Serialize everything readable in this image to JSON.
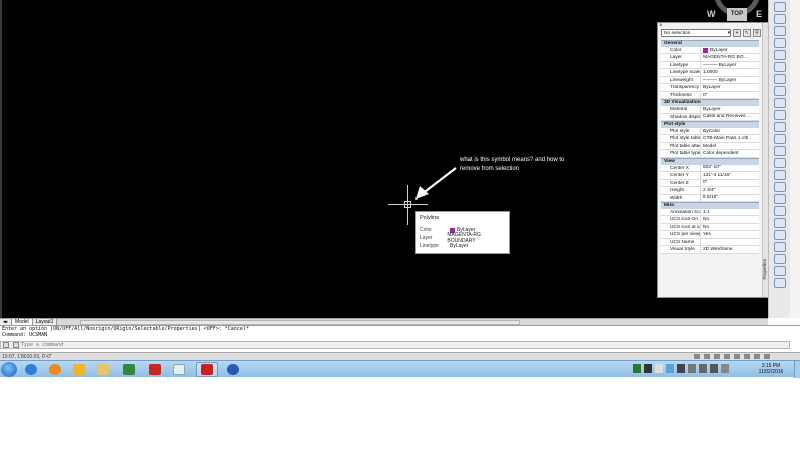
{
  "viewcube": {
    "top_label": "TOP",
    "west": "W",
    "east": "E"
  },
  "annotation": {
    "text": "what is this symbol means? and how to remove from selection"
  },
  "tooltip": {
    "title": "Polyline",
    "rows": [
      {
        "key": "Color",
        "value": "ByLayer",
        "swatch": "#a0239a"
      },
      {
        "key": "Layer",
        "value": "MAGENTA-RG BOUNDARY"
      },
      {
        "key": "Linetype",
        "value": "ByLayer"
      }
    ]
  },
  "properties": {
    "close": "×",
    "selection": "No selection",
    "palette_tab": "Properties",
    "sections": [
      {
        "title": "General",
        "rows": [
          {
            "key": "Color",
            "value": "ByLayer",
            "swatch": "#a0239a"
          },
          {
            "key": "Layer",
            "value": "MAGENTA-RG BO..."
          },
          {
            "key": "Linetype",
            "value": "——— ByLayer"
          },
          {
            "key": "Linetype scale",
            "value": "1.0000"
          },
          {
            "key": "Lineweight",
            "value": "——— ByLayer"
          },
          {
            "key": "Transparency",
            "value": "ByLayer"
          },
          {
            "key": "Thickness",
            "value": "0\""
          }
        ]
      },
      {
        "title": "3D Visualization",
        "rows": [
          {
            "key": "Material",
            "value": "ByLayer"
          },
          {
            "key": "Shadow display",
            "value": "Casts and Receives ..."
          }
        ]
      },
      {
        "title": "Plot style",
        "rows": [
          {
            "key": "Plot style",
            "value": "ByColor"
          },
          {
            "key": "Plot style table",
            "value": "CTB-Main Pass 1.ctb"
          },
          {
            "key": "Plot table attac...",
            "value": "Model"
          },
          {
            "key": "Plot table type",
            "value": "Color dependent"
          }
        ]
      },
      {
        "title": "View",
        "rows": [
          {
            "key": "Center X",
            "value": "502'-10\""
          },
          {
            "key": "Center Y",
            "value": "131'-3 11/16\""
          },
          {
            "key": "Center Z",
            "value": "0\""
          },
          {
            "key": "Height",
            "value": "2 3/4\""
          },
          {
            "key": "Width",
            "value": "6 5/16\""
          }
        ]
      },
      {
        "title": "Misc",
        "rows": [
          {
            "key": "Annotation scale",
            "value": "1:1"
          },
          {
            "key": "UCS icon On",
            "value": "No"
          },
          {
            "key": "UCS icon at ori...",
            "value": "No"
          },
          {
            "key": "UCS per viewport",
            "value": "Yes"
          },
          {
            "key": "UCS Name",
            "value": ""
          },
          {
            "key": "Visual Style",
            "value": "2D Wireframe"
          }
        ]
      }
    ]
  },
  "tabs": [
    {
      "label": "Model",
      "active": true
    },
    {
      "label": "Layout1",
      "active": false
    }
  ],
  "command": {
    "history_1": "Enter an option [ON/OFF/All/Noorigin/ORigin/Selectable/Properties] <OFF>: *Cancel*",
    "history_2": "Command: UCSMAN",
    "placeholder": "Type a command"
  },
  "status": {
    "coords": "10:07, 1'8010.03, 0'-0\""
  },
  "taskbar": {
    "time": "3:15 PM",
    "date": "11/02/2016"
  },
  "colors": {
    "canvas": "#000000",
    "layer_magenta": "#a0239a",
    "taskbar": "#9cc6ea"
  }
}
